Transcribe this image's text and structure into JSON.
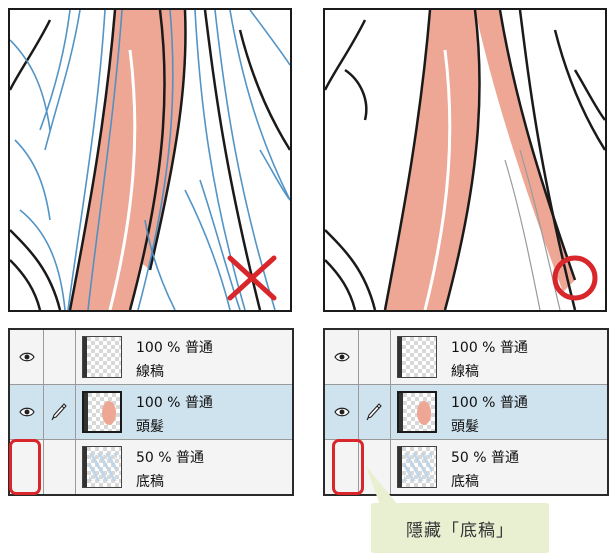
{
  "left_layers": [
    {
      "opacity": "100 %",
      "mode": "普通",
      "name": "線稿",
      "visible": true,
      "selected": false,
      "thumb": "lineart"
    },
    {
      "opacity": "100 %",
      "mode": "普通",
      "name": "頭髮",
      "visible": true,
      "selected": true,
      "thumb": "hair"
    },
    {
      "opacity": "50 %",
      "mode": "普通",
      "name": "底稿",
      "visible": false,
      "selected": false,
      "thumb": "sketch"
    }
  ],
  "right_layers": [
    {
      "opacity": "100 %",
      "mode": "普通",
      "name": "線稿",
      "visible": true,
      "selected": false,
      "thumb": "lineart"
    },
    {
      "opacity": "100 %",
      "mode": "普通",
      "name": "頭髮",
      "visible": true,
      "selected": true,
      "thumb": "hair"
    },
    {
      "opacity": "50 %",
      "mode": "普通",
      "name": "底稿",
      "visible": false,
      "selected": false,
      "thumb": "sketch"
    }
  ],
  "callout": {
    "text": "隱藏「底稿」"
  },
  "marks": {
    "wrong": "cross-mark-icon",
    "right": "circle-mark-icon"
  },
  "colors": {
    "hair": "#eea795",
    "sketch": "#4a8fc4",
    "highlight": "#d8262a",
    "selected_row": "#cfe3ef",
    "callout_bg": "#e9f0d2"
  }
}
